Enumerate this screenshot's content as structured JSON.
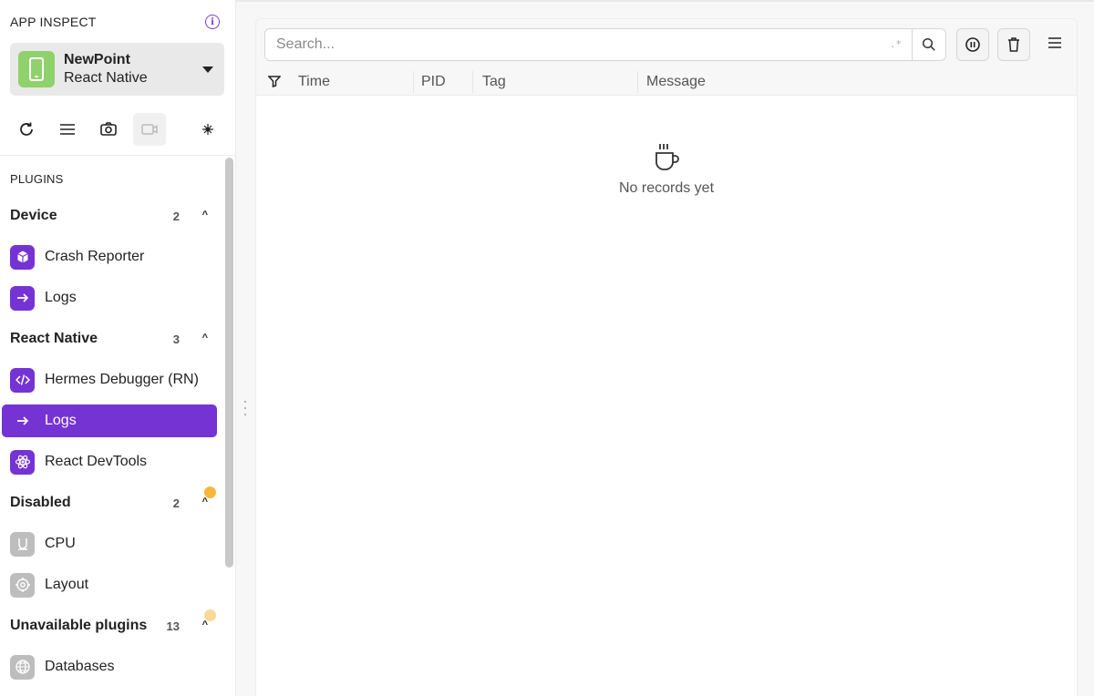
{
  "sidebar": {
    "app_inspect_title": "APP INSPECT",
    "info_icon": "i",
    "device": {
      "name": "NewPoint",
      "platform": "React Native",
      "icon": "phone-icon",
      "color": "#8fd16b"
    },
    "plugins_title": "PLUGINS",
    "groups": [
      {
        "name": "Device",
        "count": "2",
        "items": [
          {
            "label": "Crash Reporter",
            "icon": "cube-icon"
          },
          {
            "label": "Logs",
            "icon": "arrow-right-icon"
          }
        ]
      },
      {
        "name": "React Native",
        "count": "3",
        "items": [
          {
            "label": "Hermes Debugger (RN)",
            "icon": "code-icon"
          },
          {
            "label": "Logs",
            "icon": "arrow-right-icon",
            "selected": true
          },
          {
            "label": "React DevTools",
            "icon": "atom-icon"
          }
        ]
      },
      {
        "name": "Disabled",
        "count": "2",
        "badge_color": "#f6b73c",
        "items": [
          {
            "label": "CPU",
            "icon": "cpu-icon"
          },
          {
            "label": "Layout",
            "icon": "target-icon"
          }
        ]
      },
      {
        "name": "Unavailable plugins",
        "count": "13",
        "badge_color": "#fad89a",
        "items": [
          {
            "label": "Databases",
            "icon": "globe-icon"
          }
        ]
      }
    ]
  },
  "logs": {
    "search_placeholder": "Search...",
    "regex_hint": ".*",
    "columns": [
      "Time",
      "PID",
      "Tag",
      "Message"
    ],
    "empty_text": "No records yet"
  },
  "colors": {
    "accent": "#7533d4"
  }
}
